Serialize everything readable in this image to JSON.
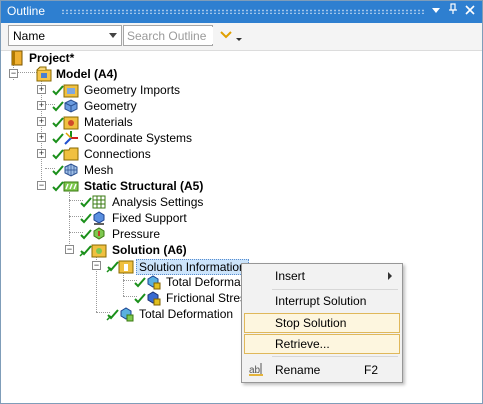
{
  "window": {
    "title": "Outline",
    "buttons": [
      "▾",
      "📌",
      "✕"
    ]
  },
  "toolbar": {
    "name_select_value": "Name",
    "search_placeholder": "Search Outline"
  },
  "tree": {
    "project": "Project*",
    "model": "Model (A4)",
    "model_children": [
      "Geometry Imports",
      "Geometry",
      "Materials",
      "Coordinate Systems",
      "Connections",
      "Mesh"
    ],
    "static_structural": "Static Structural (A5)",
    "static_children": [
      "Analysis Settings",
      "Fixed Support",
      "Pressure"
    ],
    "solution": "Solution (A6)",
    "solution_information": "Solution Information",
    "solution_info_children": [
      "Total Deformati",
      "Frictional Stress"
    ],
    "total_deformation": "Total Deformation"
  },
  "context_menu": {
    "insert": "Insert",
    "interrupt": "Interrupt Solution",
    "stop": "Stop Solution",
    "retrieve": "Retrieve...",
    "rename": "Rename",
    "rename_shortcut": "F2"
  },
  "colors": {
    "titlebar": "#2e7fd0",
    "check_green": "#1a8f1a",
    "highlight_border": "#e0b85a",
    "selection": "#cce4fb"
  }
}
